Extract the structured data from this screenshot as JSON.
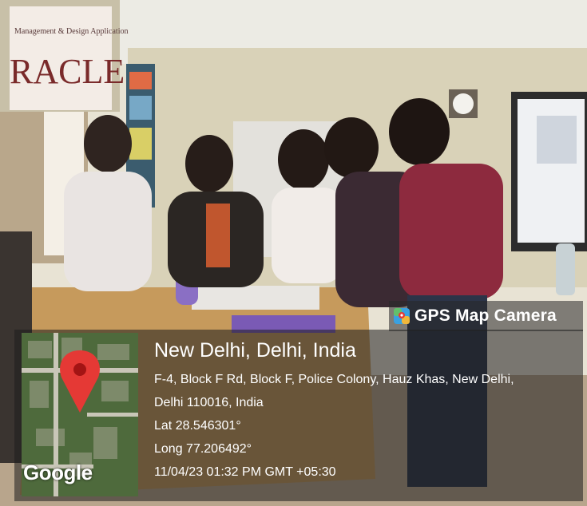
{
  "stamp": {
    "brand": "GPS Map Camera",
    "title": "New Delhi, Delhi, India",
    "address_line1": "F-4, Block F Rd, Block F, Police Colony, Hauz Khas, New Delhi,",
    "address_line2": "Delhi 110016, India",
    "latitude": "Lat 28.546301°",
    "longitude": "Long 77.206492°",
    "datetime": "11/04/23 01:32 PM GMT +05:30",
    "map_logo": "Google"
  },
  "background_sign": {
    "line1": "Management & Design Application",
    "line2": "RACLE"
  },
  "colors": {
    "pin": "#e53935",
    "panel": "#1e1e1e",
    "map_green": "#4e6a3c"
  },
  "icons": [
    "camera-location-icon",
    "map-pin-icon"
  ]
}
